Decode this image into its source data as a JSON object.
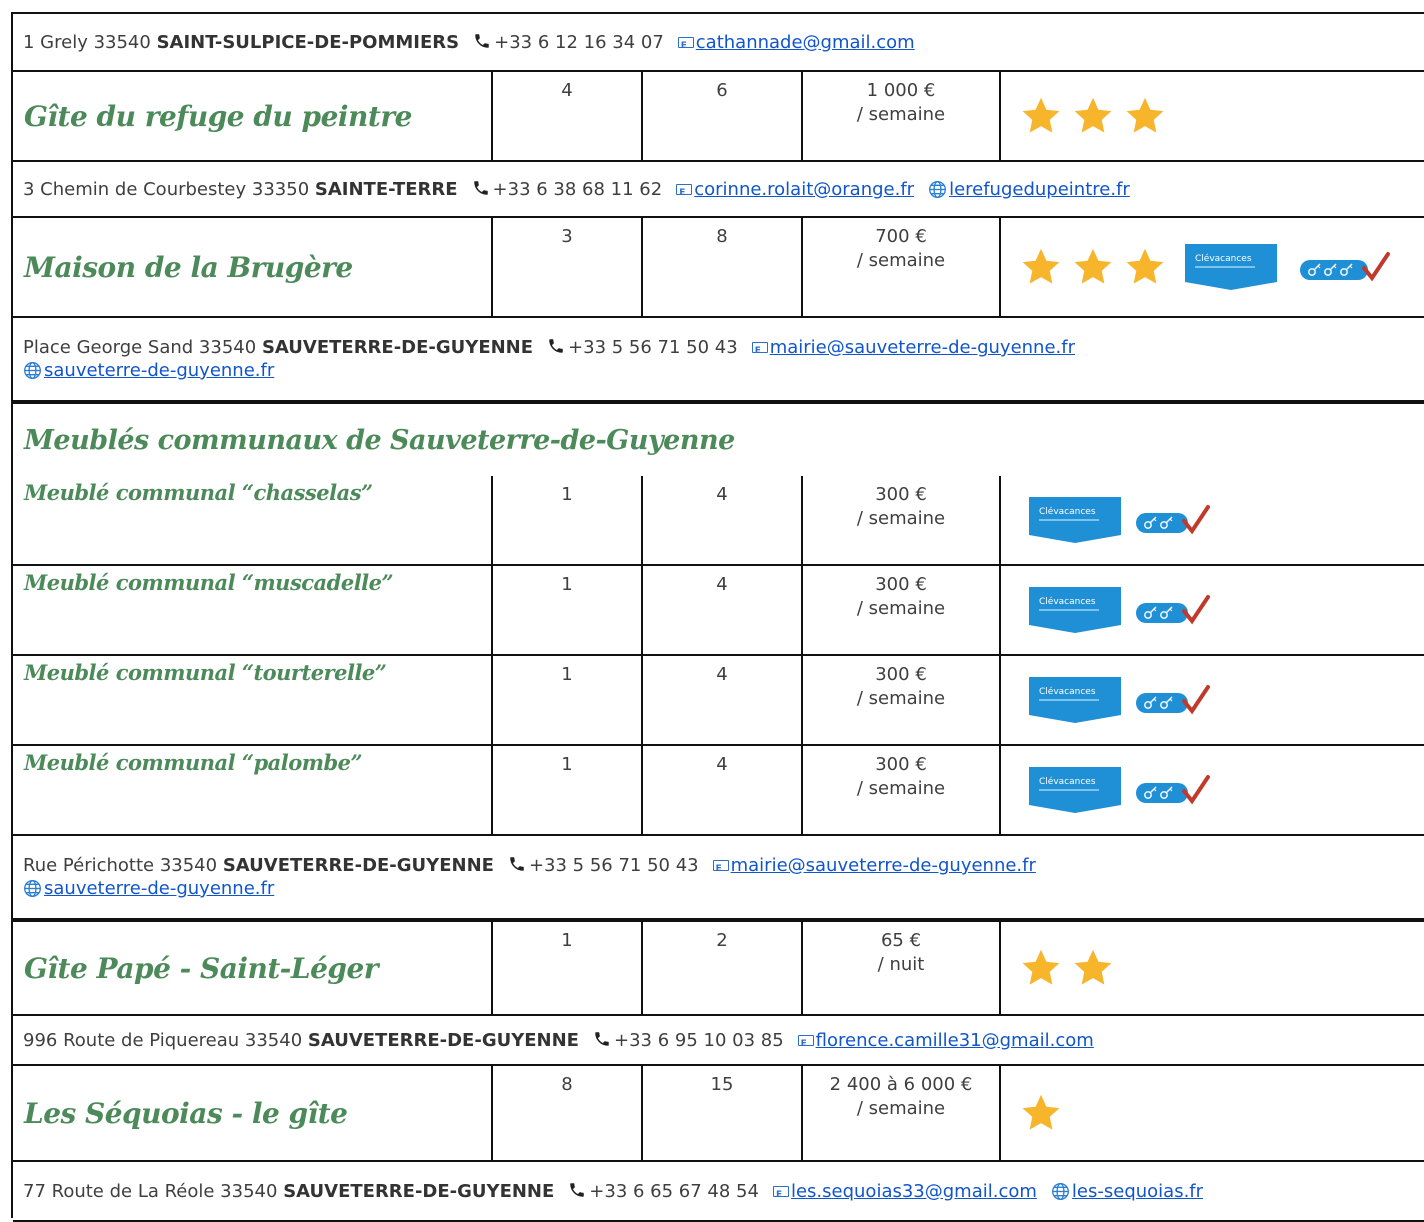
{
  "listings": [
    {
      "address": {
        "street": "1 Grely 33540",
        "town": "SAINT-SULPICE-DE-POMMIERS",
        "phone": "+33 6 12 16 34 07",
        "email": "cathannade@gmail.com"
      }
    },
    {
      "name": "Gîte du refuge du peintre",
      "rooms": "4",
      "beds": "6",
      "price": "1 000 €",
      "period": "/ semaine",
      "stars": 3,
      "clevacances": false,
      "address": {
        "street": "3 Chemin de Courbestey 33350",
        "town": "SAINTE-TERRE",
        "phone": "+33 6 38 68 11 62",
        "email": "corinne.rolait@orange.fr",
        "website": "lerefugedupeintre.fr"
      }
    },
    {
      "name": "Maison de la Brugère",
      "rooms": "3",
      "beds": "8",
      "price": "700 €",
      "period": "/ semaine",
      "stars": 3,
      "clevacances": true,
      "keys": 3,
      "address": {
        "street": "Place George Sand 33540",
        "town": "SAUVETERRE-DE-GUYENNE",
        "phone": "+33 5 56 71 50 43",
        "email": "mairie@sauveterre-de-guyenne.fr",
        "website": "sauveterre-de-guyenne.fr"
      }
    },
    {
      "group_title": "Meublés communaux de Sauveterre-de-Guyenne",
      "units": [
        {
          "name": "Meublé communal “chasselas”",
          "rooms": "1",
          "beds": "4",
          "price": "300 €",
          "period": "/ semaine",
          "clevacances": true,
          "keys": 2
        },
        {
          "name": "Meublé communal “muscadelle”",
          "rooms": "1",
          "beds": "4",
          "price": "300 €",
          "period": "/ semaine",
          "clevacances": true,
          "keys": 2
        },
        {
          "name": "Meublé communal “tourterelle”",
          "rooms": "1",
          "beds": "4",
          "price": "300 €",
          "period": "/ semaine",
          "clevacances": true,
          "keys": 2
        },
        {
          "name": "Meublé communal “palombe”",
          "rooms": "1",
          "beds": "4",
          "price": "300 €",
          "period": "/ semaine",
          "clevacances": true,
          "keys": 2
        }
      ],
      "address": {
        "street": "Rue Périchotte 33540",
        "town": "SAUVETERRE-DE-GUYENNE",
        "phone": "+33 5 56 71 50 43",
        "email": "mairie@sauveterre-de-guyenne.fr",
        "website": "sauveterre-de-guyenne.fr"
      }
    },
    {
      "name": "Gîte Papé - Saint-Léger",
      "rooms": "1",
      "beds": "2",
      "price": "65 €",
      "period": "/ nuit",
      "stars": 2,
      "clevacances": false,
      "address": {
        "street": "996 Route de Piquereau 33540",
        "town": "SAUVETERRE-DE-GUYENNE",
        "phone": "+33 6 95 10 03 85",
        "email": "florence.camille31@gmail.com"
      }
    },
    {
      "name": "Les Séquoias - le gîte",
      "rooms": "8",
      "beds": "15",
      "price": "2 400 à 6 000 €",
      "period": "/ semaine",
      "stars": 1,
      "clevacances": false,
      "address": {
        "street": "77 Route de La Réole 33540",
        "town": "SAUVETERRE-DE-GUYENNE",
        "phone": "+33 6 65 67 48 54",
        "email": "les.sequoias33@gmail.com",
        "website": "les-sequoias.fr"
      }
    }
  ],
  "colors": {
    "name_green": "#4c8a5a",
    "star_yellow": "#f7b52c",
    "link_blue": "#1155cc",
    "clevacances_blue": "#1f8fd6",
    "key_red": "#c0392b"
  }
}
